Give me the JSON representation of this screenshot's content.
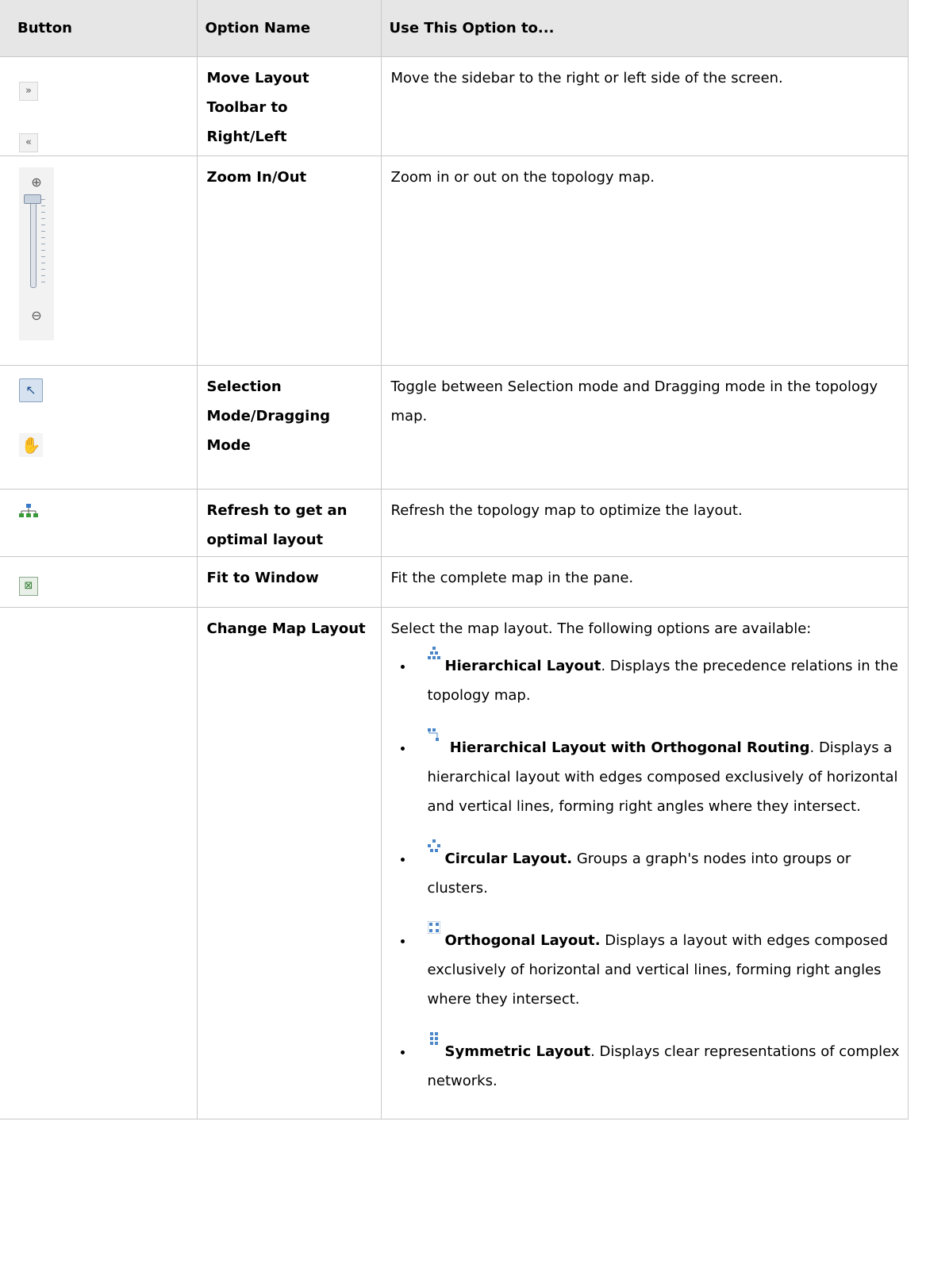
{
  "headers": {
    "button": "Button",
    "option": "Option Name",
    "use": "Use This Option to..."
  },
  "rows": [
    {
      "option": "Move Layout Toolbar to Right/Left",
      "use": "Move the sidebar to the right or left side of the screen.",
      "icons": [
        "move-right-icon",
        "move-left-icon"
      ]
    },
    {
      "option": "Zoom In/Out",
      "use": "Zoom in or out on the topology map.",
      "icons": [
        "zoom-in-icon",
        "zoom-slider",
        "zoom-out-icon"
      ]
    },
    {
      "option": "Selection Mode/Dragging Mode",
      "use": "Toggle between Selection mode and Dragging mode in the topology map.",
      "icons": [
        "selection-arrow-icon",
        "drag-hand-icon"
      ]
    },
    {
      "option": "Refresh to get an optimal layout",
      "use": "Refresh the topology map to optimize the layout.",
      "icons": [
        "refresh-layout-icon"
      ]
    },
    {
      "option": "Fit to Window",
      "use": "Fit the complete map in the pane.",
      "icons": [
        "fit-to-window-icon"
      ]
    },
    {
      "option": "Change Map Layout",
      "use": "Select the map layout. The following options are available:",
      "icons": []
    }
  ],
  "layouts": [
    {
      "name": "Hierarchical Layout",
      "sep": ".",
      "text": " Displays the precedence relations in the topology map.",
      "icon": "hierarchical-layout-icon"
    },
    {
      "name": " Hierarchical Layout with Orthogonal Routing",
      "sep": ".",
      "text": " Displays a hierarchical layout with edges composed exclusively of horizontal and vertical lines, forming right angles where they intersect.",
      "icon": "orthogonal-routing-icon"
    },
    {
      "name": "Circular Layout.",
      "sep": "",
      "text": " Groups a graph's nodes into groups or clusters.",
      "icon": "circular-layout-icon"
    },
    {
      "name": "Orthogonal Layout.",
      "sep": "",
      "text": " Displays a layout with edges composed exclusively of horizontal and vertical lines, forming right angles where they intersect.",
      "icon": "orthogonal-layout-icon"
    },
    {
      "name": "Symmetric Layout",
      "sep": ".",
      "text": " Displays clear representations of complex networks.",
      "icon": "symmetric-layout-icon"
    }
  ],
  "glyphs": {
    "right": "»",
    "left": "«",
    "zoom_in": "⊕",
    "zoom_out": "⊖",
    "arrow": "↖",
    "hand": "✋",
    "fit": "⊠"
  }
}
